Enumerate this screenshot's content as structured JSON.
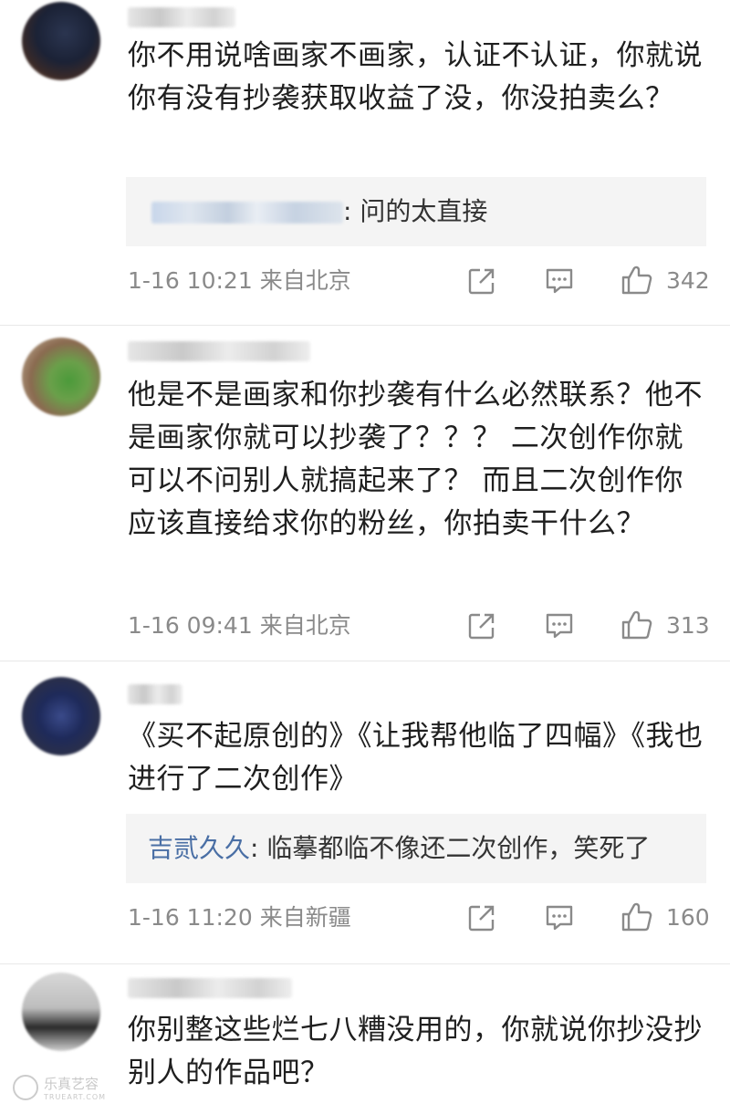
{
  "comments": [
    {
      "text": "你不用说啥画家不画家，认证不认证，你就说你有没有抄袭获取收益了没，你没拍卖么？",
      "reply": {
        "author": "",
        "text": ": 问的太直接"
      },
      "time": "1-16 10:21",
      "location": "来自北京",
      "likes": "342"
    },
    {
      "text": "他是不是画家和你抄袭有什么必然联系？他不是画家你就可以抄袭了？？？ 二次创作你就可以不问别人就搞起来了？ 而且二次创作你应该直接给求你的粉丝，你拍卖干什么？",
      "time": "1-16 09:41",
      "location": "来自北京",
      "likes": "313"
    },
    {
      "text": "《买不起原创的》《让我帮他临了四幅》《我也进行了二次创作》",
      "reply": {
        "author": "吉贰久久",
        "text": ": 临摹都临不像还二次创作，笑死了"
      },
      "time": "1-16 11:20",
      "location": "来自新疆",
      "likes": "160"
    },
    {
      "text": "你别整这些烂七八糟没用的，你就说你抄没抄别人的作品吧？"
    }
  ],
  "icons": {
    "share": "share-icon",
    "comment": "comment-icon",
    "like": "thumbs-up-icon"
  },
  "watermark": {
    "name": "乐真艺容",
    "sub": "TRUEART.COM"
  },
  "colors": {
    "reply_author": "#4a6fa5",
    "meta": "#8a8a8a",
    "reply_bg": "#f4f4f4"
  }
}
